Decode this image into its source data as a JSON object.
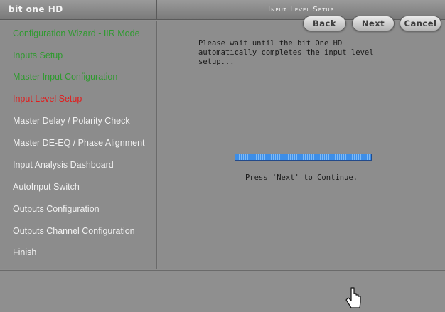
{
  "header": {
    "app_title": "bit one HD",
    "step_title": "Input Level Setup"
  },
  "sidebar": {
    "items": [
      {
        "label": "Configuration Wizard - IIR Mode",
        "state": "done"
      },
      {
        "label": "Inputs Setup",
        "state": "done"
      },
      {
        "label": "Master Input Configuration",
        "state": "done"
      },
      {
        "label": "Input Level Setup",
        "state": "current"
      },
      {
        "label": "Master Delay / Polarity Check",
        "state": "pending"
      },
      {
        "label": "Master DE-EQ / Phase Alignment",
        "state": "pending"
      },
      {
        "label": "Input Analysis Dashboard",
        "state": "pending"
      },
      {
        "label": "AutoInput Switch",
        "state": "pending"
      },
      {
        "label": "Outputs Configuration",
        "state": "pending"
      },
      {
        "label": "Outputs Channel Configuration",
        "state": "pending"
      },
      {
        "label": "Finish",
        "state": "pending"
      }
    ]
  },
  "main": {
    "message": "Please wait until the bit One HD\nautomatically completes the input level\nsetup...",
    "progress_fraction": 1.0,
    "continue_text": "Press 'Next' to Continue."
  },
  "footer": {
    "back_label": "Back",
    "next_label": "Next",
    "cancel_label": "Cancel"
  },
  "colors": {
    "done": "#2f9a2f",
    "current": "#e21c1c",
    "pending": "#f1f1f1",
    "progress": "#3d8ee8"
  }
}
